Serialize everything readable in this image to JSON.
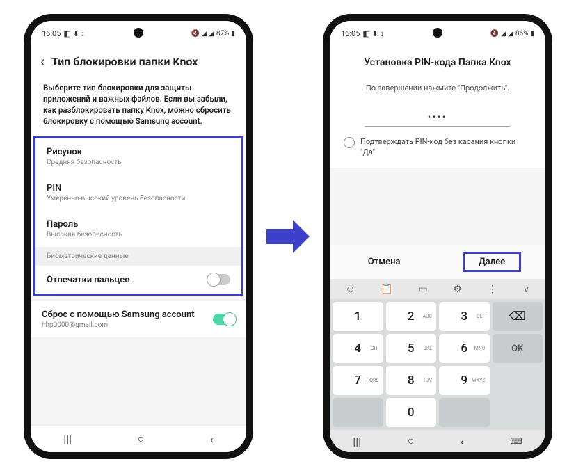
{
  "status": {
    "time": "16:05",
    "icons_left": "◧ ⬇ ↕",
    "signal": "◢ ◢",
    "battery1": "87%",
    "battery2": "86%",
    "vol_icon": "🔇"
  },
  "phone1": {
    "back": "‹",
    "title": "Тип блокировки папки Knox",
    "description": "Выберите тип блокировки для защиты приложений и важных файлов. Если вы забыли, как разблокировать папку Knox, можно сбросить блокировку с помощью Samsung account.",
    "items": [
      {
        "title": "Рисунок",
        "sub": "Средняя безопасность"
      },
      {
        "title": "PIN",
        "sub": "Умеренно-высокий уровень безопасности"
      },
      {
        "title": "Пароль",
        "sub": "Высокая безопасность"
      }
    ],
    "bio_section": "Биометрические данные",
    "fingerprint": "Отпечатки пальцев",
    "reset_title": "Сброс с помощью Samsung account",
    "reset_sub": "hhp0000@gmail.com"
  },
  "phone2": {
    "title": "Установка PIN-кода Папка Knox",
    "instruction": "По завершении нажмите \"Продолжить\".",
    "pin_dots": "••••",
    "confirm_text": "Подтверждать PIN-код без касания кнопки \"Да\"",
    "cancel": "Отмена",
    "next": "Далее",
    "toolbar": [
      "☺",
      "📋",
      "▭",
      "⚙",
      "⋮",
      "∨"
    ],
    "keys": [
      {
        "n": "1",
        "l": ""
      },
      {
        "n": "2",
        "l": "ABC"
      },
      {
        "n": "3",
        "l": "DEF"
      },
      {
        "n": "4",
        "l": "GHI"
      },
      {
        "n": "5",
        "l": "JKL"
      },
      {
        "n": "6",
        "l": "MNO"
      },
      {
        "n": "7",
        "l": "PQRS"
      },
      {
        "n": "8",
        "l": "TUV"
      },
      {
        "n": "9",
        "l": "WXYZ"
      }
    ],
    "backspace": "⌫",
    "zero": "0",
    "ok": "OK"
  },
  "nav": {
    "recent": "|||",
    "home": "○",
    "back": "‹",
    "kb": "⌨"
  }
}
